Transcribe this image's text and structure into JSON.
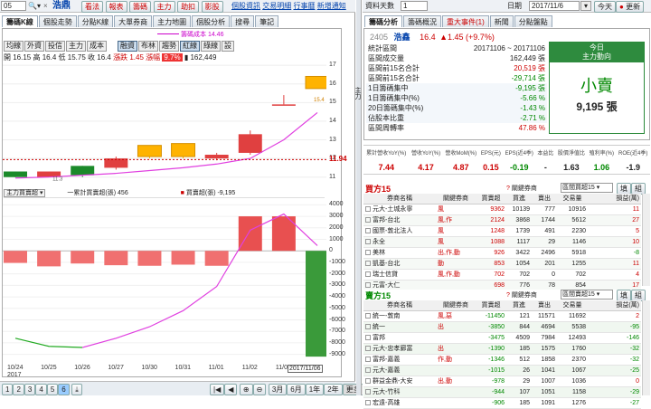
{
  "left": {
    "stock_code_partial": "05",
    "stock_name": "浩鼎",
    "top_buttons": [
      "看法",
      "報表",
      "籌碼",
      "主力",
      "助扣",
      "影股"
    ],
    "links": [
      "個股資訊",
      "交易明細",
      "行事曆",
      "新增通知"
    ],
    "tabs": [
      "籌碼K線",
      "個股走勢",
      "分點K線",
      "大單券商",
      "主力地圖",
      "個股分析",
      "搜尋",
      "筆記"
    ],
    "indicator_chips": [
      "均線",
      "外資",
      "投信",
      "主力",
      "成本"
    ],
    "toolbar_chips": [
      "融資",
      "布林",
      "趨勢",
      "紅線",
      "綠線",
      "設"
    ],
    "annotation": "籌碼成本 14.46",
    "ohlc": {
      "open_label": "開",
      "open": "16.15",
      "high_label": "高",
      "high": "16.4",
      "low_label": "低",
      "low": "15.75",
      "close_label": "收",
      "close": "16.4",
      "chg_label": "漲跌",
      "chg": "1.45",
      "pct_label": "漲幅",
      "pct": "9.7%",
      "vol": "162,449"
    },
    "price_axis": [
      "17",
      "16",
      "15",
      "14",
      "13",
      "12",
      "11"
    ],
    "current_price": "11.94",
    "box_high": "15.4",
    "box_low": "11.3",
    "lower_title": "主力買賣超",
    "legend_line": "一累計買賣超(張) 456",
    "legend_bar": "買賣超(張) -9,195",
    "vol_axis": [
      "4000",
      "3000",
      "2000",
      "1000",
      "0",
      "-1000",
      "-2000",
      "-3000",
      "-4000",
      "-5000",
      "-6000",
      "-7000",
      "-8000",
      "-9000"
    ],
    "dates": [
      "10/24",
      "10/25",
      "10/26",
      "10/27",
      "10/30",
      "10/31",
      "11/01",
      "11/02",
      "11/03"
    ],
    "year": "2017",
    "cursor_date": "2017/11/06",
    "page_buttons": [
      "1",
      "2",
      "3",
      "4",
      "5",
      "6"
    ],
    "period_buttons": [
      "3月",
      "6月",
      "1年",
      "2年",
      "更多"
    ],
    "vertical_label": "主力"
  },
  "chart_data": [
    {
      "type": "candlestick",
      "categories": [
        "10/24",
        "10/25",
        "10/26",
        "10/27",
        "10/30",
        "10/31",
        "11/01",
        "11/02",
        "11/03",
        "11/06"
      ],
      "series": [
        {
          "open": 11.0,
          "close": 11.3,
          "high": 11.3,
          "low": 11.0,
          "color": "green"
        },
        {
          "open": 11.0,
          "close": 11.3,
          "high": 11.3,
          "low": 11.0,
          "color": "red"
        },
        {
          "open": 11.1,
          "close": 11.6,
          "high": 11.6,
          "low": 11.0,
          "color": "green"
        },
        {
          "open": 11.5,
          "close": 12.0,
          "high": 12.1,
          "low": 11.4,
          "color": "red"
        },
        {
          "open": 12.7,
          "close": 12.1,
          "high": 12.7,
          "low": 12.0,
          "color": "orange"
        },
        {
          "open": 12.8,
          "close": 12.1,
          "high": 12.8,
          "low": 12.0,
          "color": "orange"
        },
        {
          "open": 12.2,
          "close": 12.0,
          "high": 12.3,
          "low": 11.9,
          "color": "red"
        },
        {
          "open": 13.3,
          "close": 12.3,
          "high": 13.5,
          "low": 12.2,
          "color": "red"
        },
        {
          "open": 14.9,
          "close": 14.9,
          "high": 15.4,
          "low": 14.9,
          "color": "red"
        },
        {
          "open": 15.75,
          "close": 16.4,
          "high": 16.4,
          "low": 15.75,
          "color": "orange"
        }
      ],
      "ylim": [
        10.5,
        17.2
      ]
    },
    {
      "type": "bar",
      "title": "主力買賣超",
      "categories": [
        "10/24",
        "10/25",
        "10/26",
        "10/27",
        "10/30",
        "10/31",
        "11/01",
        "11/02",
        "11/03",
        "11/06"
      ],
      "values": [
        -1050,
        -1350,
        -1100,
        -1250,
        -1300,
        -1200,
        -1300,
        3000,
        3000,
        -9195
      ],
      "cumulative": [
        -7600,
        -8300,
        -8400,
        -7600,
        -6600,
        -5200,
        -3100,
        1800,
        3200,
        456
      ],
      "ylim": [
        -9500,
        4500
      ]
    }
  ],
  "right": {
    "top_label": "資料天數",
    "top_days": "1",
    "date_label": "日期",
    "date_value": "2017/11/6",
    "today_btn": "今天",
    "refresh_btn": "更新",
    "tabs": [
      "籌碼分析",
      "籌碼概況",
      "重大事件(1)",
      "新聞",
      "分點盤點"
    ],
    "stock_code": "2405",
    "stock_name": "浩鑫",
    "price": "16.4",
    "change": "▲1.45 (+9.7%)",
    "stats": [
      {
        "label": "統計區間",
        "value": "20171106 ~ 20171106"
      },
      {
        "label": "區間成交量",
        "value": "162,449 張"
      },
      {
        "label": "區間前15名合計",
        "value": "20,519 張"
      },
      {
        "label": "區間前15名合計",
        "value": "-29,714 張"
      },
      {
        "label": "1日籌碼集中",
        "value": "-9,195 張"
      },
      {
        "label": "1日籌碼集中(%)",
        "value": "-5.66 %"
      },
      {
        "label": "20日籌碼集中(%)",
        "value": "-1.43 %"
      },
      {
        "label": "佔股本比重",
        "value": "-2.71 %"
      },
      {
        "label": "區間周轉率",
        "value": "47.86 %"
      }
    ],
    "today_box": {
      "title1": "今日",
      "title2": "主力動向",
      "status": "小賣",
      "qty": "9,195 張"
    },
    "metrics_headers": [
      "累計營收YoY(%)",
      "營收YoY(%)",
      "營收MoM(%)",
      "EPS(元)",
      "EPS(近4季)",
      "本益比",
      "股價淨值比",
      "殖利率(%)",
      "ROE(近4季)"
    ],
    "metrics_values": [
      "7.44",
      "4.17",
      "4.87",
      "0.15",
      "-0.19",
      "-",
      "1.63",
      "1.06",
      "-1.9"
    ],
    "buy_title": "買方15",
    "sell_title": "賣方15",
    "filter_label": "關鍵券商",
    "buy_select": "區間買超15",
    "sell_select": "區間賣超15",
    "sort_btn": "填",
    "filter_btn": "組",
    "list_headers": [
      "券商名稱",
      "關鍵券商",
      "買賣超",
      "買進",
      "賣出",
      "交易量",
      "損益(萬)"
    ],
    "buy_rows": [
      [
        "元大-土城永寧",
        "風",
        "9362",
        "10139",
        "777",
        "10916",
        "11"
      ],
      [
        "富邦-台北",
        "風,作",
        "2124",
        "3868",
        "1744",
        "5612",
        "27"
      ],
      [
        "國票-敦北法人",
        "風",
        "1248",
        "1739",
        "491",
        "2230",
        "5"
      ],
      [
        "永全",
        "風",
        "1088",
        "1117",
        "29",
        "1146",
        "10"
      ],
      [
        "美林",
        "出,作,動",
        "926",
        "3422",
        "2496",
        "5918",
        "-8"
      ],
      [
        "凱基-台北",
        "動",
        "853",
        "1054",
        "201",
        "1255",
        "11"
      ],
      [
        "瑞士信貸",
        "風,作,動",
        "702",
        "702",
        "0",
        "702",
        "4"
      ],
      [
        "元富-大仁",
        "",
        "698",
        "776",
        "78",
        "854",
        "17"
      ],
      [
        "元大-松山",
        "風",
        "658",
        "772",
        "114",
        "886",
        "-2"
      ]
    ],
    "sell_rows": [
      [
        "統一-敦南",
        "風,惡",
        "-11450",
        "121",
        "11571",
        "11692",
        "2"
      ],
      [
        "統一",
        "出",
        "-3850",
        "844",
        "4694",
        "5538",
        "-95"
      ],
      [
        "富邦",
        "",
        "-3475",
        "4509",
        "7984",
        "12493",
        "-146"
      ],
      [
        "元大-忠孝廊富",
        "出",
        "-1390",
        "185",
        "1575",
        "1760",
        "-32"
      ],
      [
        "富邦-嘉義",
        "作,動",
        "-1346",
        "512",
        "1858",
        "2370",
        "-32"
      ],
      [
        "元大-嘉義",
        "",
        "-1015",
        "26",
        "1041",
        "1067",
        "-25"
      ],
      [
        "群益金鼎-大安",
        "出,動",
        "-978",
        "29",
        "1007",
        "1036",
        "0"
      ],
      [
        "元大-竹科",
        "",
        "-944",
        "107",
        "1051",
        "1158",
        "-29"
      ],
      [
        "宏遠-高雄",
        "",
        "-906",
        "185",
        "1091",
        "1276",
        "-27"
      ]
    ]
  }
}
